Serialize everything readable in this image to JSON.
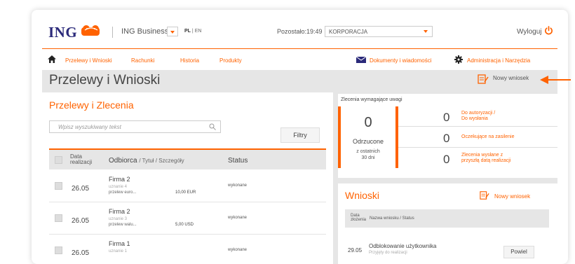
{
  "topbar": {
    "logo": "ING",
    "business": "ING Business",
    "lang_pl": "PL",
    "lang_sep": "|",
    "lang_en": "EN",
    "timer_label": "Pozostało:",
    "timer_value": "19:49",
    "company": "KORPORACJA",
    "logout": "Wyloguj"
  },
  "nav": {
    "items": [
      "Przelewy i Wnioski",
      "Rachunki",
      "Historia",
      "Produkty"
    ],
    "right": [
      "Dokumenty i wiadomości",
      "Administracja i Narzędzia"
    ]
  },
  "page": {
    "title": "Przelewy i Wnioski",
    "new_request": "Nowy wniosek"
  },
  "transfers": {
    "title": "Przelewy i Zlecenia",
    "search_placeholder": "Wpisz wyszukiwany tekst",
    "filter_btn": "Filtry",
    "headers": {
      "date_line1": "Data",
      "date_line2": "realizacji",
      "recipient": "Odbiorca",
      "recipient_sub": "/ Tytuł / Szczegóły",
      "status": "Status"
    },
    "rows": [
      {
        "date": "26.05",
        "name": "Firma 2",
        "sub": "uznanie 4",
        "type": "przelew euro...",
        "amount": "10,00 EUR",
        "status": "wykonane"
      },
      {
        "date": "26.05",
        "name": "Firma 2",
        "sub": "uznanie 3",
        "type": "przelew walu...",
        "amount": "5,00 USD",
        "status": "wykonane"
      },
      {
        "date": "26.05",
        "name": "Firma 1",
        "sub": "uznanie 1",
        "type": "",
        "amount": "",
        "status": "wykonane"
      }
    ]
  },
  "attention": {
    "title": "Zlecenia wymagające uwagi",
    "rejected": {
      "count": "0",
      "label": "Odrzucone",
      "sub1": "z ostatnich",
      "sub2": "30 dni"
    },
    "items": [
      {
        "count": "0",
        "line1": "Do autoryzacji /",
        "line2": "Do wysłania"
      },
      {
        "count": "0",
        "line1": "Oczekujące na zasilenie",
        "line2": ""
      },
      {
        "count": "0",
        "line1": "Zlecenia wysłane z",
        "line2": "przyszłą datą realizacji"
      }
    ]
  },
  "requests": {
    "title": "Wnioski",
    "new_request": "Nowy wniosek",
    "header_date1": "Data",
    "header_date2": "złożenia",
    "header_name": "Nazwa wniosku / Status",
    "row": {
      "date": "29.05",
      "name": "Odblokowanie użytkownika",
      "status": "Przyjęty do realizacji",
      "button": "Powiel"
    }
  },
  "colors": {
    "accent": "#ff6200",
    "brand": "#2b2a7a"
  }
}
